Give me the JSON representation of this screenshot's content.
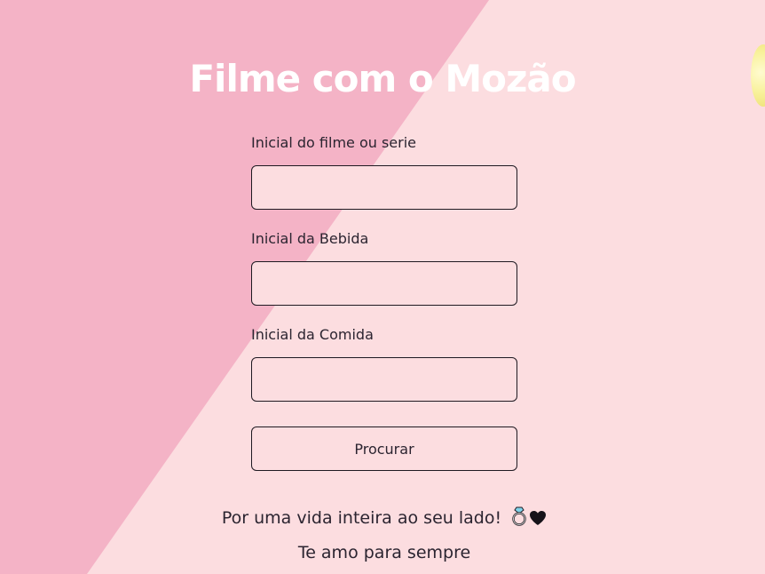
{
  "page": {
    "title": "Filme com o Mozão"
  },
  "form": {
    "fields": [
      {
        "label": "Inicial do filme ou serie",
        "value": "",
        "placeholder": ""
      },
      {
        "label": "Inicial da Bebida",
        "value": "",
        "placeholder": ""
      },
      {
        "label": "Inicial da Comida",
        "value": "",
        "placeholder": ""
      }
    ],
    "submit_label": "Procurar"
  },
  "footer": {
    "line1": "Por uma vida inteira ao seu lado!",
    "line2": "Te amo para sempre"
  },
  "icons": {
    "ring": "ring-icon",
    "heart": "black-heart-icon"
  },
  "colors": {
    "background": "#fcdde0",
    "diagonal": "#f4b3c6",
    "title": "#ffffff",
    "text": "#2b2430",
    "border": "#1f1a22"
  }
}
